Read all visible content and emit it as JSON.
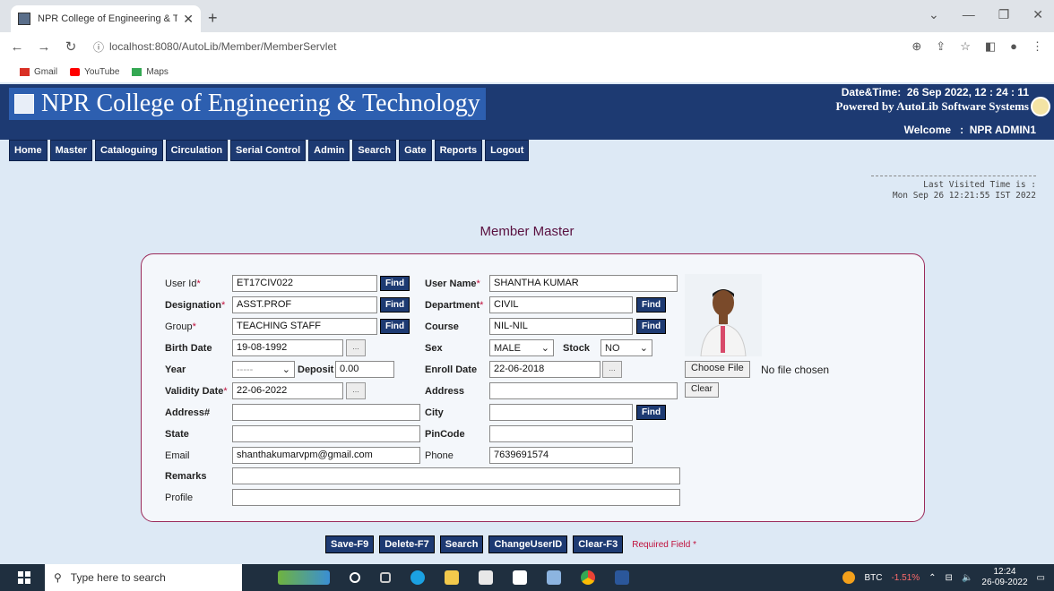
{
  "browser": {
    "tab_title": "NPR College of Engineering & Te",
    "tab_close": "✕",
    "new_tab": "+",
    "url": "localhost:8080/AutoLib/Member/MemberServlet",
    "bookmarks": [
      "Gmail",
      "YouTube",
      "Maps"
    ]
  },
  "header": {
    "title": "NPR College of Engineering & Technology",
    "datetime_label": "Date&Time:",
    "datetime_value": "26 Sep 2022, 12 : 24 : 11",
    "powered_by": "Powered by AutoLib Software Systems",
    "welcome_label": "Welcome",
    "welcome_sep": ":",
    "welcome_user": "NPR ADMIN1"
  },
  "menu": {
    "items": [
      "Home",
      "Master",
      "Cataloguing",
      "Circulation",
      "Serial Control",
      "Admin",
      "Search",
      "Gate",
      "Reports",
      "Logout"
    ]
  },
  "last_visited": {
    "label": "Last Visited Time is :",
    "value": "Mon Sep 26 12:21:55 IST 2022"
  },
  "page_title": "Member Master",
  "form": {
    "user_id": {
      "label": "User Id",
      "value": "ET17CIV022"
    },
    "user_name": {
      "label": "User Name",
      "value": "SHANTHA KUMAR"
    },
    "designation": {
      "label": "Designation",
      "value": "ASST.PROF"
    },
    "department": {
      "label": "Department",
      "value": "CIVIL"
    },
    "group": {
      "label": "Group",
      "value": "TEACHING STAFF"
    },
    "course": {
      "label": "Course",
      "value": "NIL-NIL"
    },
    "birth_date": {
      "label": "Birth Date",
      "value": "19-08-1992"
    },
    "sex": {
      "label": "Sex",
      "value": "MALE"
    },
    "stock": {
      "label": "Stock",
      "value": "NO"
    },
    "year": {
      "label": "Year",
      "value": "-----"
    },
    "deposit": {
      "label": "Deposit",
      "value": "0.00"
    },
    "enroll_date": {
      "label": "Enroll Date",
      "value": "22-06-2018"
    },
    "validity_date": {
      "label": "Validity Date",
      "value": "22-06-2022"
    },
    "address": {
      "label": "Address",
      "value": ""
    },
    "address_hash": {
      "label": "Address#",
      "value": ""
    },
    "city": {
      "label": "City",
      "value": ""
    },
    "state": {
      "label": "State",
      "value": ""
    },
    "pincode": {
      "label": "PinCode",
      "value": ""
    },
    "email": {
      "label": "Email",
      "value": "shanthakumarvpm@gmail.com"
    },
    "phone": {
      "label": "Phone",
      "value": "7639691574"
    },
    "remarks": {
      "label": "Remarks",
      "value": ""
    },
    "profile": {
      "label": "Profile",
      "value": ""
    },
    "find_label": "Find",
    "cal_label": "...",
    "required_mark": "*",
    "choose_file": "Choose File",
    "no_file": "No file chosen",
    "clear_photo": "Clear"
  },
  "actions": {
    "save": "Save-F9",
    "delete": "Delete-F7",
    "search": "Search",
    "change_user_id": "ChangeUserID",
    "clear": "Clear-F3",
    "required_note": "Required Field *"
  },
  "taskbar": {
    "search_placeholder": "Type here to search",
    "btc_label": "BTC",
    "btc_change": "-1.51%",
    "time": "12:24",
    "date": "26-09-2022"
  },
  "colors": {
    "header_bg": "#1d3a72",
    "title_highlight": "#2d5fb0",
    "page_title": "#5a1140",
    "form_border": "#9b2a5a",
    "required": "#c0103c"
  }
}
